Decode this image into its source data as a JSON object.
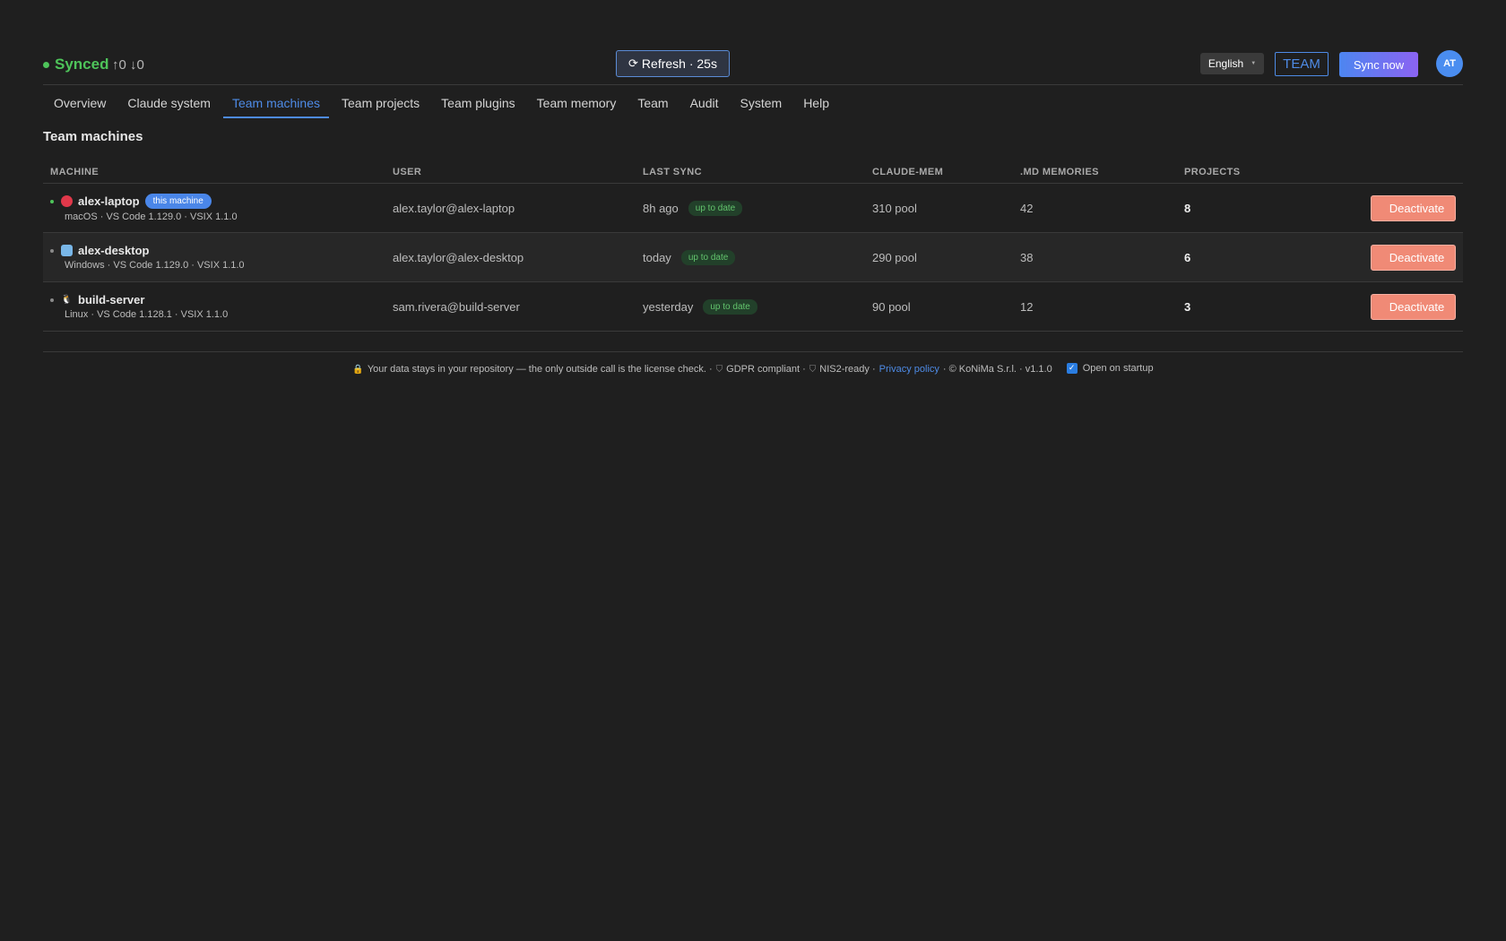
{
  "header": {
    "status": "Synced",
    "counters": "↑0 ↓0",
    "refresh_icon": "⟳",
    "refresh_label": "Refresh · 25s",
    "language": "English",
    "team_badge": "TEAM",
    "sync_now": "Sync now",
    "avatar": "AT"
  },
  "tabs": [
    {
      "label": "Overview"
    },
    {
      "label": "Claude system"
    },
    {
      "label": "Team machines",
      "active": true
    },
    {
      "label": "Team projects"
    },
    {
      "label": "Team plugins"
    },
    {
      "label": "Team memory"
    },
    {
      "label": "Team"
    },
    {
      "label": "Audit"
    },
    {
      "label": "System"
    },
    {
      "label": "Help"
    }
  ],
  "section_title": "Team machines",
  "table": {
    "columns": [
      "MACHINE",
      "USER",
      "LAST SYNC",
      "CLAUDE-MEM",
      ".MD MEMORIES",
      "PROJECTS"
    ],
    "rows": [
      {
        "name": "alex-laptop",
        "badge": "this machine",
        "os_icon": "apple-icon",
        "sub": "macOS · VS Code 1.129.0 · VSIX 1.1.0",
        "user": "alex.taylor@alex-laptop",
        "last_sync": "8h ago",
        "sync_status": "up to date",
        "claude_mem": "310 pool",
        "md_memories": "42",
        "projects": "8",
        "action": "Deactivate",
        "online": true
      },
      {
        "name": "alex-desktop",
        "badge": "",
        "os_icon": "windows-icon",
        "sub": "Windows · VS Code 1.129.0 · VSIX 1.1.0",
        "user": "alex.taylor@alex-desktop",
        "last_sync": "today",
        "sync_status": "up to date",
        "claude_mem": "290 pool",
        "md_memories": "38",
        "projects": "6",
        "action": "Deactivate",
        "online": false
      },
      {
        "name": "build-server",
        "badge": "",
        "os_icon": "linux-icon",
        "sub": "Linux · VS Code 1.128.1 · VSIX 1.1.0",
        "user": "sam.rivera@build-server",
        "last_sync": "yesterday",
        "sync_status": "up to date",
        "claude_mem": "90 pool",
        "md_memories": "12",
        "projects": "3",
        "action": "Deactivate",
        "online": false
      }
    ]
  },
  "footer": {
    "privacy_text": "Your data stays in your repository — the only outside call is the license check. ·",
    "gdpr": "GDPR compliant ·",
    "nis2": "NIS2-ready ·",
    "privacy_link": "Privacy policy",
    "copyright": "· © KoNiMa S.r.l. · v1.1.0",
    "open_on_startup": "Open on startup",
    "open_on_startup_checked": true
  }
}
